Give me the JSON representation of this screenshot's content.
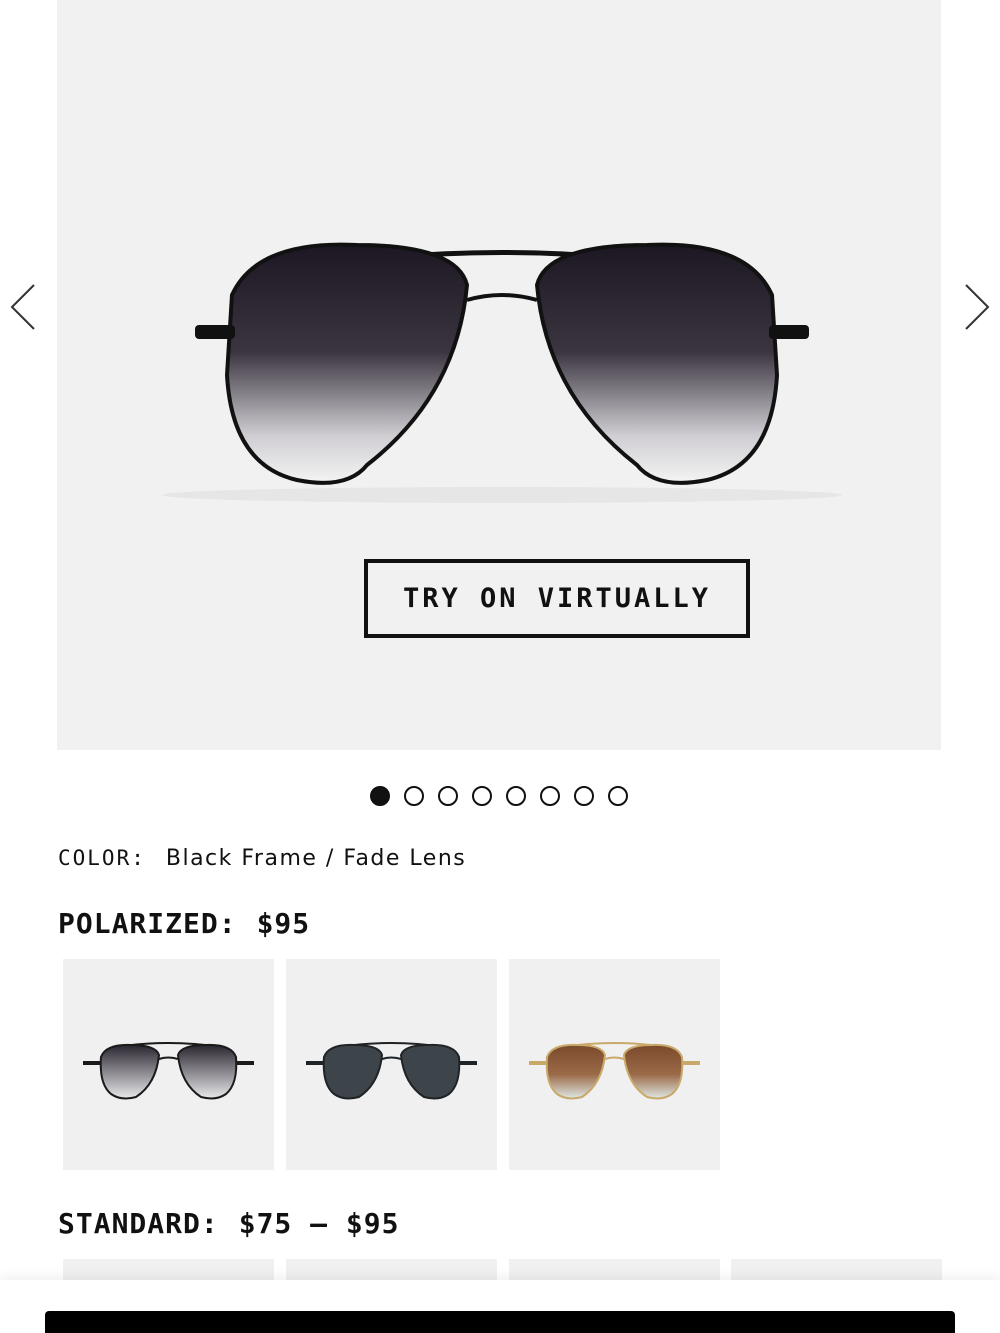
{
  "gallery": {
    "try_on_label": "TRY ON VIRTUALLY",
    "slide_count": 8,
    "active_slide": 1
  },
  "product": {
    "color_label": "COLOR:",
    "color_value": "Black Frame / Fade Lens"
  },
  "polarized": {
    "label": "POLARIZED:",
    "price": "$95",
    "swatches": [
      {
        "frame": "#1a1a1a",
        "lens_top": "#2a2530",
        "lens_bottom": "#e8e8ea"
      },
      {
        "frame": "#1f2326",
        "lens_top": "#3a4146",
        "lens_bottom": "#4c555b"
      },
      {
        "frame": "#c9a96a",
        "lens_top": "#7a4a2c",
        "lens_bottom": "#dfe7e4"
      }
    ]
  },
  "standard": {
    "label": "STANDARD:",
    "price": "$75 – $95"
  },
  "icons": {
    "prev": "chevron-left-icon",
    "next": "chevron-right-icon"
  }
}
